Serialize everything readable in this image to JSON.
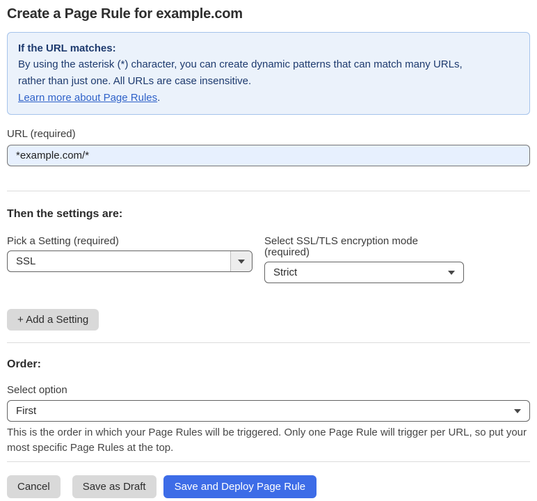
{
  "page": {
    "title": "Create a Page Rule for example.com"
  },
  "info_box": {
    "heading": "If the URL matches:",
    "line1": "By using the asterisk (*) character, you can create dynamic patterns that can match many URLs,",
    "line2": "rather than just one. All URLs are case insensitive.",
    "link_label": "Learn more about Page Rules",
    "link_suffix": "."
  },
  "url_field": {
    "label": "URL (required)",
    "value": "*example.com/*"
  },
  "settings": {
    "heading": "Then the settings are:",
    "pick_setting": {
      "label": "Pick a Setting (required)",
      "selected": "SSL"
    },
    "encryption_mode": {
      "label": "Select SSL/TLS encryption mode (required)",
      "selected": "Strict"
    },
    "add_button_label": "+ Add a Setting"
  },
  "order": {
    "heading": "Order:",
    "label": "Select option",
    "selected": "First",
    "help_line1": "This is the order in which your Page Rules will be triggered. Only one Page Rule will trigger per URL, so put your",
    "help_line2": "most specific Page Rules at the top."
  },
  "footer": {
    "cancel": "Cancel",
    "save_draft": "Save as Draft",
    "save_deploy": "Save and Deploy Page Rule"
  },
  "colors": {
    "info_bg": "#EBF2FB",
    "info_border": "#A5C3EB",
    "info_text": "#1D3A6E",
    "link": "#2F62C9",
    "input_bg": "#E7F0FE",
    "button_gray": "#D9D9D9",
    "button_primary": "#3D6CE7",
    "divider": "#DCDCDC"
  },
  "icons": {
    "dropdown_arrow": "chevron-down-icon"
  }
}
